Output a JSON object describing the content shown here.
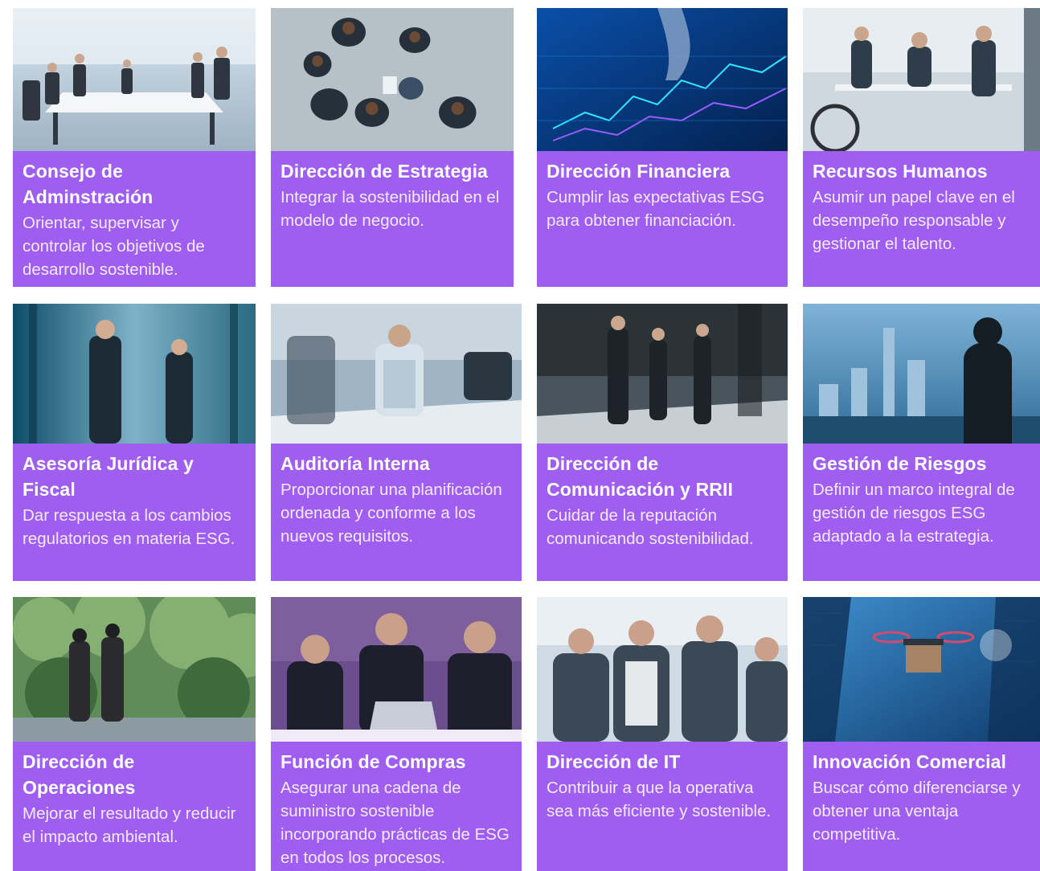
{
  "cards": [
    {
      "title": "Consejo de Adminstración",
      "desc": "Orientar, supervisar y controlar los objetivos de desarrollo sostenible.",
      "image": "boardroom-meeting-photo"
    },
    {
      "title": "Dirección de Estrategia",
      "desc": "Integrar la sostenibilidad en el modelo de negocio.",
      "image": "overhead-team-photo"
    },
    {
      "title": "Dirección Financiera",
      "desc": "Cumplir las expectativas ESG para obtener financiación.",
      "image": "financial-chart-screen-photo"
    },
    {
      "title": "Recursos Humanos",
      "desc": "Asumir un papel clave en el desempeño responsable y gestionar el talento.",
      "image": "office-team-photo"
    },
    {
      "title": "Asesoría Jurídica y Fiscal",
      "desc": "Dar respuesta a los cambios regulatorios en materia ESG.",
      "image": "two-people-talking-photo"
    },
    {
      "title": "Auditoría Interna",
      "desc": "Proporcionar una planificación ordenada y conforme a los nuevos requisitos.",
      "image": "meeting-table-photo"
    },
    {
      "title": "Dirección de Comunicación y RRII",
      "desc": "Cuidar de la reputación comunicando sostenibilidad.",
      "image": "people-walking-photo"
    },
    {
      "title": "Gestión de Riesgos",
      "desc": "Definir un marco integral de gestión de riesgos ESG adaptado a la estrategia.",
      "image": "city-skyline-photo"
    },
    {
      "title": "Dirección de Operaciones",
      "desc": "Mejorar el resultado y reducir el impacto ambiental.",
      "image": "forest-view-photo"
    },
    {
      "title": "Función de Compras",
      "desc": "Asegurar una cadena de suministro sostenible incorporando prácticas de ESG en todos los procesos.",
      "image": "laptop-meeting-photo"
    },
    {
      "title": "Dirección de IT",
      "desc": "Contribuir a que la operativa sea más eficiente y sostenible.",
      "image": "office-discussion-photo"
    },
    {
      "title": "Innovación Comercial",
      "desc": "Buscar cómo diferenciarse y obtener una ventaja competitiva.",
      "image": "delivery-drone-photo"
    }
  ],
  "colors": {
    "panel": "#a05ef0"
  }
}
